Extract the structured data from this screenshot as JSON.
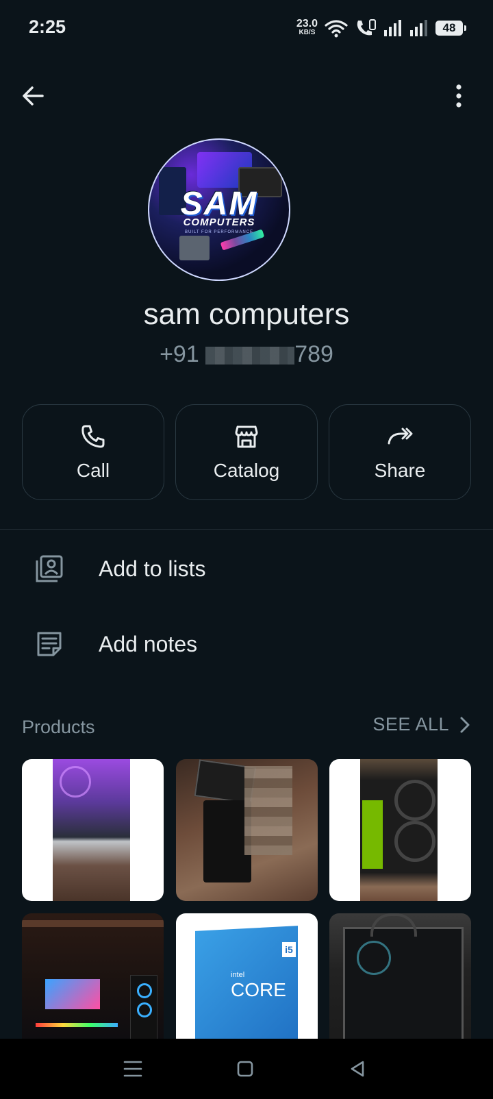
{
  "status_bar": {
    "time": "2:25",
    "net_speed_value": "23.0",
    "net_speed_unit": "KB/S",
    "battery": "48"
  },
  "top_bar": {
    "back_icon": "arrow-left-icon",
    "menu_icon": "more-vert-icon"
  },
  "profile": {
    "avatar_logo_main": "SAM",
    "avatar_logo_sub": "COMPUTERS",
    "avatar_logo_tag": "BUILT FOR PERFORMANCE",
    "name": "sam computers",
    "phone_prefix": "+91 ",
    "phone_suffix": "789"
  },
  "actions": [
    {
      "label": "Call",
      "icon": "phone-icon"
    },
    {
      "label": "Catalog",
      "icon": "storefront-icon"
    },
    {
      "label": "Share",
      "icon": "share-forward-icon"
    }
  ],
  "menu": [
    {
      "label": "Add to lists",
      "icon": "lists-icon"
    },
    {
      "label": "Add notes",
      "icon": "notes-icon"
    }
  ],
  "products": {
    "title": "Products",
    "see_all": "SEE ALL",
    "items": [
      {
        "name": "product-pc-rgb-fans"
      },
      {
        "name": "product-rtx-box"
      },
      {
        "name": "product-ventus-3x-rtx"
      },
      {
        "name": "product-gaming-setup"
      },
      {
        "name": "product-intel-core-i5"
      },
      {
        "name": "product-pc-case"
      }
    ],
    "intel_brand": "intel",
    "intel_core": "CORE",
    "intel_model": "i5"
  },
  "nav_bar": {
    "recent_icon": "menu-lines-icon",
    "home_icon": "square-home-icon",
    "back_icon": "triangle-back-icon"
  },
  "colors": {
    "background": "#0b141a",
    "text_primary": "#e9edef",
    "text_secondary": "#8696a0",
    "border": "#2a3942"
  }
}
